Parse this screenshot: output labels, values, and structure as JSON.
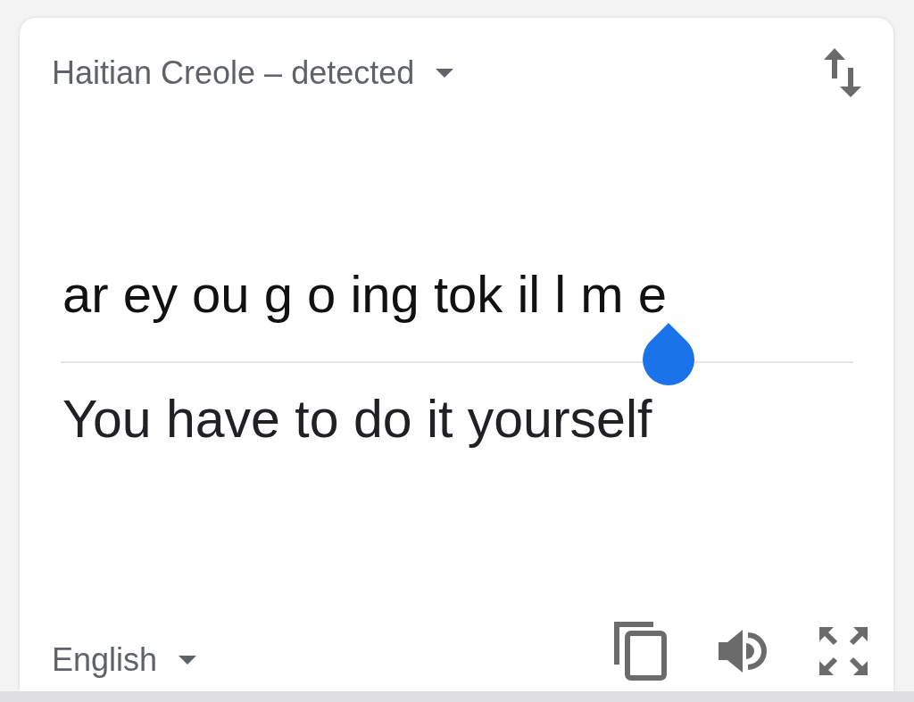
{
  "source_language": {
    "label": "Haitian Creole – detected"
  },
  "input": {
    "value": "ar ey ou g o ing tok il l m e"
  },
  "translation": {
    "text": "You have to do it yourself"
  },
  "target_language": {
    "label": "English"
  }
}
